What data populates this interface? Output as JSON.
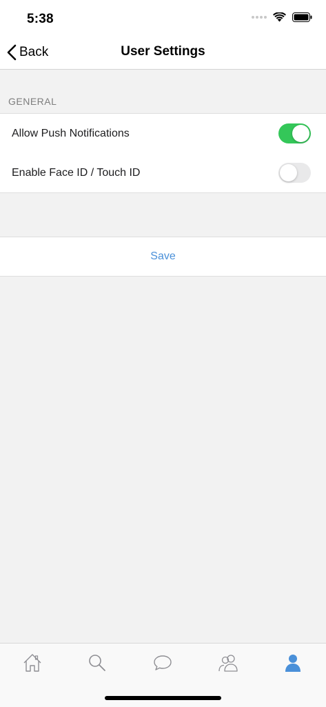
{
  "status_bar": {
    "time": "5:38"
  },
  "nav": {
    "back_label": "Back",
    "title": "User Settings"
  },
  "section": {
    "header": "GENERAL"
  },
  "settings": [
    {
      "label": "Allow Push Notifications",
      "enabled": true
    },
    {
      "label": "Enable Face ID / Touch ID",
      "enabled": false
    }
  ],
  "save": {
    "label": "Save"
  },
  "colors": {
    "toggle_on": "#34c759",
    "accent": "#4a90d9",
    "active_tab": "#4a90d9",
    "inactive_tab": "#8e8e93"
  },
  "tabs": [
    {
      "icon": "home-icon",
      "active": false
    },
    {
      "icon": "search-icon",
      "active": false
    },
    {
      "icon": "chat-bubble-icon",
      "active": false
    },
    {
      "icon": "people-icon",
      "active": false
    },
    {
      "icon": "profile-icon",
      "active": true
    }
  ]
}
